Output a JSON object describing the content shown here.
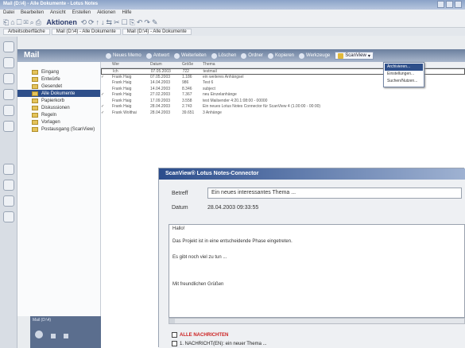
{
  "window": {
    "title": "Mail (D:\\4) - Alle Dokumente - Lotus Notes"
  },
  "menu": [
    "Datei",
    "Bearbeiten",
    "Ansicht",
    "Erstellen",
    "Aktionen",
    "Hilfe"
  ],
  "toolbar": {
    "label": "Aktionen"
  },
  "tabs": [
    "Arbeitsoberfläche",
    "Mail (D:\\4) - Alle Dokumente",
    "Mail (D:\\4) - Alle Dokumente"
  ],
  "nav": {
    "title": "Mail",
    "items": [
      "Eingang",
      "Entwürfe",
      "Gesendet",
      "Alle Dokumente",
      "Papierkorb",
      "Diskussionen",
      "Regeln",
      "Vorlagen",
      "Postausgang (ScanView)"
    ],
    "selected_index": 3,
    "footer": "Mail (D:\\4)"
  },
  "actions": [
    "Neues Memo",
    "Antwort",
    "Weiterleiten",
    "Löschen",
    "Ordner",
    "Kopieren",
    "Werkzeuge"
  ],
  "scanview": {
    "label": "ScanView",
    "menu": [
      "Archivieren...",
      "Einstellungen...",
      "Suchen/Nutzen..."
    ]
  },
  "list": {
    "columns": [
      "Wer",
      "Datum",
      "Größe",
      "Thema"
    ],
    "rows": [
      {
        "mark": "",
        "who": "Ich",
        "date": "07.05.2003",
        "size": "722",
        "subject": "testmail"
      },
      {
        "mark": "✓",
        "who": "Frank Haig",
        "date": "07.05.2003",
        "size": "1.186",
        "subject": "ein weiteres Anhängsel"
      },
      {
        "mark": "",
        "who": "Frank Haig",
        "date": "14.04.2003",
        "size": "986",
        "subject": "Test 6"
      },
      {
        "mark": "",
        "who": "Frank Haig",
        "date": "14.04.2003",
        "size": "8.346",
        "subject": "subject"
      },
      {
        "mark": "✓",
        "who": "Frank Haig",
        "date": "27.02.2003",
        "size": "7.367",
        "subject": "neu Einzelanhänge"
      },
      {
        "mark": "",
        "who": "Frank Haig",
        "date": "17.09.2003",
        "size": "3.558",
        "subject": "test Mailsender 4:20.1:08:00 - 00000"
      },
      {
        "mark": "✓",
        "who": "Frank Haig",
        "date": "28.04.2003",
        "size": "2.743",
        "subject": "Ein neues Lotus Notes Connector für ScanView 4 (1.00:00 - 00:00)"
      },
      {
        "mark": "✓",
        "who": "Frank Wolthai",
        "date": "28.04.2003",
        "size": "39.651",
        "subject": "3 Anhänge"
      }
    ]
  },
  "dialog": {
    "title": "ScanView® Lotus Notes-Connector",
    "subject_label": "Betreff",
    "subject_value": "Ein neues interessantes Thema ...",
    "date_label": "Datum",
    "date_value": "28.04.2003 09:33:55",
    "body": [
      "Hallo!",
      "Das Projekt ist in eine entscheidende Phase eingetreten.",
      "Es gibt noch viel zu tun ...",
      "Mit freundlichen Grüßen"
    ],
    "check_all": "ALLE NACHRICHTEN",
    "check_item": "1. NACHRICHT(EN): ein neuer Thema ..."
  }
}
